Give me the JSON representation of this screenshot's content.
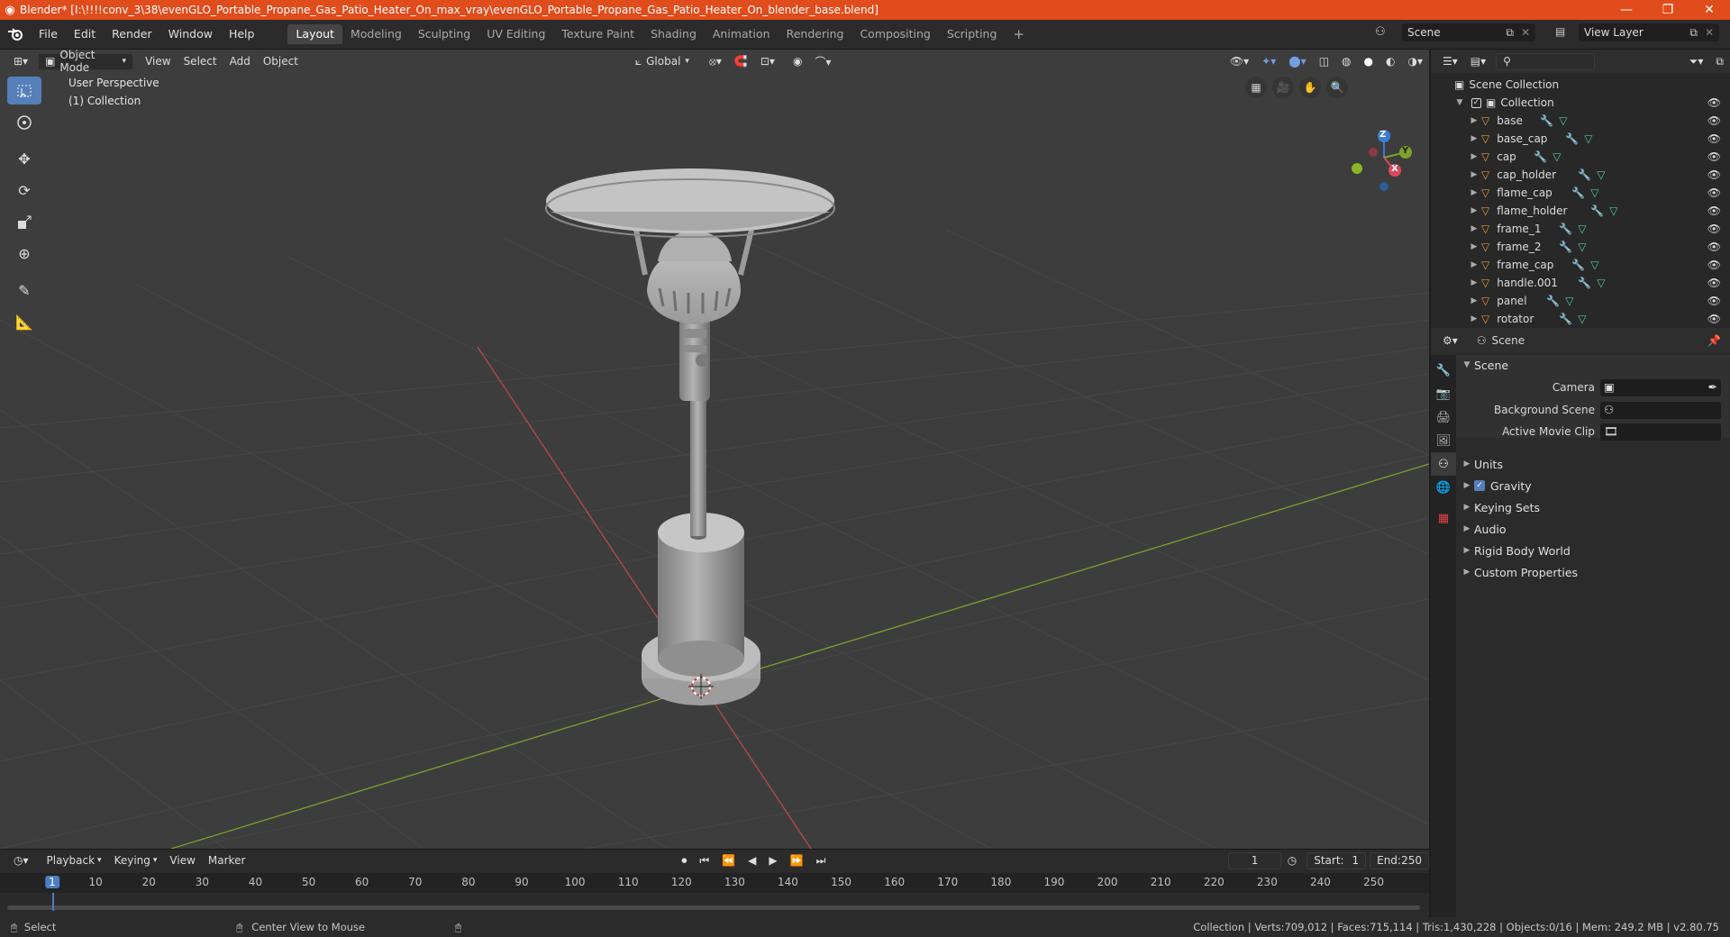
{
  "window": {
    "title": "Blender* [I:\\!!!!conv_3\\38\\evenGLO_Portable_Propane_Gas_Patio_Heater_On_max_vray\\evenGLO_Portable_Propane_Gas_Patio_Heater_On_blender_base.blend]",
    "controls": [
      "—",
      "❐",
      "✕"
    ]
  },
  "menus": [
    "File",
    "Edit",
    "Render",
    "Window",
    "Help"
  ],
  "workspaces": [
    "Layout",
    "Modeling",
    "Sculpting",
    "UV Editing",
    "Texture Paint",
    "Shading",
    "Animation",
    "Rendering",
    "Compositing",
    "Scripting"
  ],
  "active_workspace": "Layout",
  "add_tab": "+",
  "scene_name": "Scene",
  "view_layer": "View Layer",
  "viewport": {
    "mode": "Object Mode",
    "menus": [
      "View",
      "Select",
      "Add",
      "Object"
    ],
    "orientation": "Global",
    "perspective_label": "User Perspective",
    "collection_label": "(1) Collection",
    "gizmo": {
      "x": "X",
      "y": "Y",
      "z": "Z"
    },
    "colors": {
      "background": "#3d3d3d",
      "grid": "#4a4a4a",
      "x_axis": "#b84a4a",
      "y_axis": "#7ea02a",
      "select": "#557fb8"
    }
  },
  "outliner": {
    "root": "Scene Collection",
    "collection": "Collection",
    "objects": [
      "base",
      "base_cap",
      "cap",
      "cap_holder",
      "flame_cap",
      "flame_holder",
      "frame_1",
      "frame_2",
      "frame_cap",
      "handle.001",
      "panel",
      "rotator"
    ]
  },
  "properties": {
    "header": "Scene",
    "panel_title": "Scene",
    "fields": {
      "camera": "Camera",
      "background_scene": "Background Scene",
      "active_movie_clip": "Active Movie Clip"
    },
    "panels": [
      "Units",
      "Gravity",
      "Keying Sets",
      "Audio",
      "Rigid Body World",
      "Custom Properties"
    ],
    "gravity_enabled": true
  },
  "timeline": {
    "menus": [
      "Playback",
      "Keying",
      "View",
      "Marker"
    ],
    "current_frame": "1",
    "start_label": "Start:",
    "start": "1",
    "end_label": "End:",
    "end": "250",
    "ticks": [
      "1",
      "10",
      "20",
      "30",
      "40",
      "50",
      "60",
      "70",
      "80",
      "90",
      "100",
      "110",
      "120",
      "130",
      "140",
      "150",
      "160",
      "170",
      "180",
      "190",
      "200",
      "210",
      "220",
      "230",
      "240",
      "250"
    ]
  },
  "status": {
    "left_action": "Select",
    "middle_action": "Center View to Mouse",
    "stats": "Collection | Verts:709,012 | Faces:715,114 | Tris:1,430,228 | Objects:0/16 | Mem: 249.2 MB | v2.80.75"
  }
}
